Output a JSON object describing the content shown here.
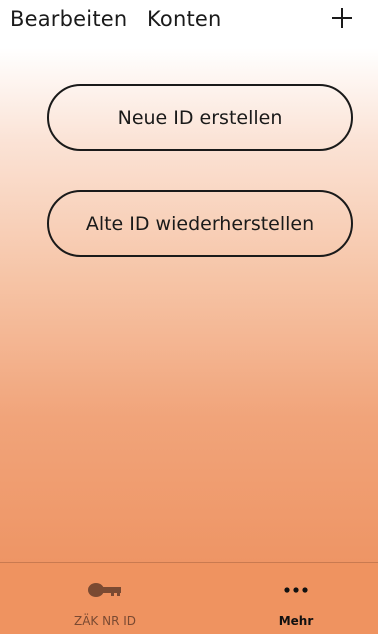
{
  "header": {
    "edit_label": "Bearbeiten",
    "accounts_label": "Konten",
    "add_icon": "plus-icon"
  },
  "main": {
    "actions": [
      {
        "label": "Neue ID erstellen"
      },
      {
        "label": "Alte ID wiederherstellen"
      }
    ]
  },
  "tabbar": {
    "tabs": [
      {
        "label": "ZÄK NR ID",
        "icon": "key-icon",
        "selected": false
      },
      {
        "label": "Mehr",
        "icon": "more-dots-icon",
        "selected": true
      }
    ]
  },
  "colors": {
    "background_top": "#ffffff",
    "background_bottom": "#ee9565",
    "tabbar": "#ef9360",
    "tab_inactive": "#7a4a32",
    "tab_active": "#111111"
  }
}
